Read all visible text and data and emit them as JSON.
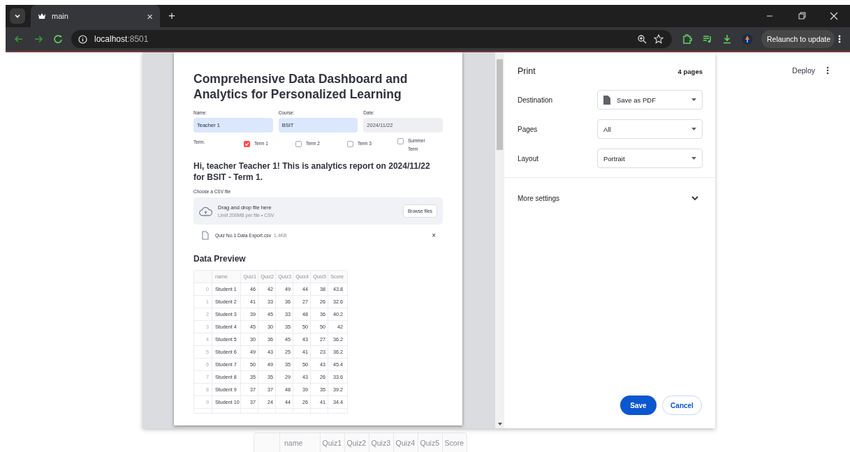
{
  "browser": {
    "tab_title": "main",
    "close_tab": "×",
    "new_tab": "+",
    "url_host": "localhost",
    "url_port": ":8501",
    "relaunch": "Relaunch to update"
  },
  "app": {
    "deploy": "Deploy",
    "background_table": {
      "columns": [
        "",
        "name",
        "Quiz1",
        "Quiz2",
        "Quiz3",
        "Quiz4",
        "Quiz5",
        "Score"
      ]
    }
  },
  "preview": {
    "title": "Comprehensive Data Dashboard and Analytics for Personalized Learning",
    "fields": [
      {
        "label": "Name:",
        "value": "Teacher 1",
        "autofilled": true
      },
      {
        "label": "Course:",
        "value": "BSIT",
        "autofilled": true
      },
      {
        "label": "Date:",
        "value": "2024/11/22",
        "autofilled": false
      }
    ],
    "term_label": "Term:",
    "terms": [
      {
        "label": "Term 1",
        "checked": true
      },
      {
        "label": "Term 2",
        "checked": false
      },
      {
        "label": "Term 3",
        "checked": false
      },
      {
        "label": "Summer Term",
        "checked": false
      }
    ],
    "greeting": "Hi, teacher Teacher 1! This is analytics report on 2024/11/22 for BSIT - Term 1.",
    "uploader": {
      "label": "Choose a CSV file",
      "prompt": "Drag and drop file here",
      "limit": "Limit 200MB per file • CSV",
      "button": "Browse files"
    },
    "file": {
      "name": "Quiz No.1 Data Export.csv",
      "size": "1.4KB",
      "remove": "×"
    },
    "section": "Data Preview",
    "table": {
      "columns": [
        "",
        "name",
        "Quiz1",
        "Quiz2",
        "Quiz3",
        "Quiz4",
        "Quiz5",
        "Score"
      ],
      "rows": [
        [
          "0",
          "Student 1",
          "46",
          "42",
          "49",
          "44",
          "38",
          "43.8"
        ],
        [
          "1",
          "Student 2",
          "41",
          "33",
          "36",
          "27",
          "26",
          "32.6"
        ],
        [
          "2",
          "Student 3",
          "39",
          "45",
          "33",
          "48",
          "36",
          "40.2"
        ],
        [
          "3",
          "Student 4",
          "45",
          "30",
          "35",
          "50",
          "50",
          "42"
        ],
        [
          "4",
          "Student 5",
          "30",
          "36",
          "45",
          "43",
          "27",
          "36.2"
        ],
        [
          "5",
          "Student 6",
          "49",
          "43",
          "25",
          "41",
          "23",
          "36.2"
        ],
        [
          "6",
          "Student 7",
          "50",
          "49",
          "35",
          "50",
          "43",
          "45.4"
        ],
        [
          "7",
          "Student 8",
          "35",
          "35",
          "29",
          "43",
          "26",
          "33.6"
        ],
        [
          "8",
          "Student 9",
          "37",
          "37",
          "48",
          "39",
          "35",
          "39.2"
        ],
        [
          "9",
          "Student 10",
          "37",
          "24",
          "44",
          "26",
          "41",
          "34.4"
        ]
      ]
    }
  },
  "print": {
    "title": "Print",
    "pages": "4 pages",
    "settings": [
      {
        "label": "Destination",
        "value": "Save as PDF",
        "kind": "printer"
      },
      {
        "label": "Pages",
        "value": "All",
        "kind": "plain"
      },
      {
        "label": "Layout",
        "value": "Portrait",
        "kind": "plain"
      }
    ],
    "more": "More settings",
    "save": "Save",
    "cancel": "Cancel"
  }
}
